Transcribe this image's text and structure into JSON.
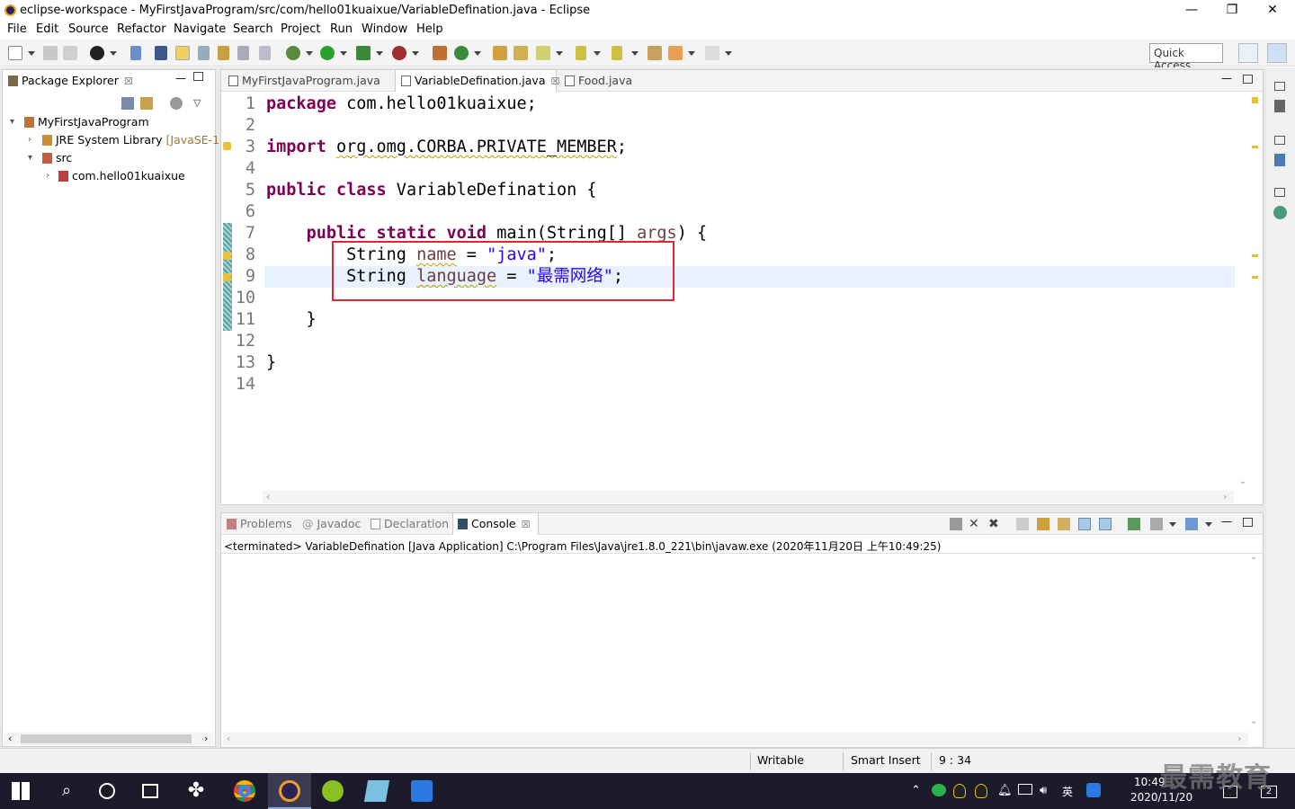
{
  "window": {
    "title": "eclipse-workspace - MyFirstJavaProgram/src/com/hello01kuaixue/VariableDefination.java - Eclipse",
    "minimize": "—",
    "maximize": "❐",
    "close": "✕"
  },
  "menu": [
    "File",
    "Edit",
    "Source",
    "Refactor",
    "Navigate",
    "Search",
    "Project",
    "Run",
    "Window",
    "Help"
  ],
  "toolbar": {
    "quick_access": "Quick Access"
  },
  "package_explorer": {
    "title": "Package Explorer",
    "close": "☒",
    "tree": {
      "project": "MyFirstJavaProgram",
      "jre": "JRE System Library",
      "jre_version": "[JavaSE-1.",
      "src": "src",
      "package": "com.hello01kuaixue"
    }
  },
  "editor": {
    "tabs": [
      {
        "label": "MyFirstJavaProgram.java"
      },
      {
        "label": "VariableDefination.java"
      },
      {
        "label": "Food.java"
      }
    ],
    "line_numbers": [
      "1",
      "2",
      "3",
      "4",
      "5",
      "6",
      "7",
      "8",
      "9",
      "10",
      "11",
      "12",
      "13",
      "14"
    ],
    "code": {
      "l1_kw": "package",
      "l1_rest": " com.hello01kuaixue;",
      "l3_kw": "import",
      "l3_rest": "org.omg.CORBA.PRIVATE_MEMBER",
      "l3_end": ";",
      "l5_kw1": "public",
      "l5_kw2": "class",
      "l5_rest": " VariableDefination {",
      "l7_indent": "    ",
      "l7_kw1": "public",
      "l7_kw2": "static",
      "l7_kw3": "void",
      "l7_rest": " main(String[] ",
      "l7_arg": "args",
      "l7_end": ") {",
      "l8_type": "        String ",
      "l8_var": "name",
      "l8_eq": " = ",
      "l8_str": "\"java\"",
      "l8_end": ";",
      "l9_type": "        String ",
      "l9_var": "language",
      "l9_eq": " = ",
      "l9_str": "\"最需网络\"",
      "l9_end": ";",
      "l11": "    }",
      "l13": "}"
    }
  },
  "console": {
    "tabs": [
      {
        "label": "Problems"
      },
      {
        "label": "Javadoc"
      },
      {
        "label": "Declaration"
      },
      {
        "label": "Console"
      }
    ],
    "status": "<terminated> VariableDefination [Java Application] C:\\Program Files\\Java\\jre1.8.0_221\\bin\\javaw.exe (2020年11月20日 上午10:49:25)"
  },
  "statusbar": {
    "writable": "Writable",
    "insert_mode": "Smart Insert",
    "position": "9 : 34"
  },
  "taskbar": {
    "time": "10:49",
    "date": "2020/11/20",
    "ime": "英",
    "notif_count": "2"
  },
  "watermark": "最需教育",
  "colors": {
    "keyword": "#7f0055",
    "string": "#2a00ff",
    "local_var": "#6a3e3e",
    "highlight_box": "#e0282e",
    "current_line": "#e8f2fe"
  }
}
